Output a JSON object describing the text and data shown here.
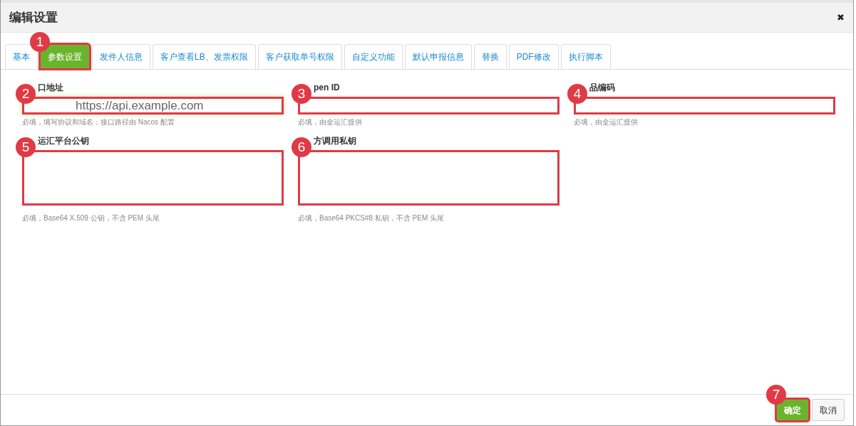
{
  "dialog": {
    "title": "编辑设置",
    "close": "✖"
  },
  "tabs": [
    {
      "label": "基本",
      "selected": false
    },
    {
      "label": "参数设置",
      "selected": true,
      "callout": "1"
    },
    {
      "label": "发件人信息",
      "selected": false
    },
    {
      "label": "客户查看LB、发票权限",
      "selected": false
    },
    {
      "label": "客户获取单号权限",
      "selected": false
    },
    {
      "label": "自定义功能",
      "selected": false
    },
    {
      "label": "默认申报信息",
      "selected": false
    },
    {
      "label": "替换",
      "selected": false
    },
    {
      "label": "PDF修改",
      "selected": false
    },
    {
      "label": "执行脚本",
      "selected": false
    }
  ],
  "fields": [
    {
      "kind": "input",
      "label": "口地址",
      "value": "https://api.example.com",
      "hint": "必填，填写协议和域名；接口路径由 Nacos 配置",
      "callout": "2",
      "focused": true
    },
    {
      "kind": "input",
      "label": "pen ID",
      "hint": "必填，由全运汇提供",
      "callout": "3",
      "focused": false
    },
    {
      "kind": "input",
      "label": "品编码",
      "hint": "必填，由全运汇提供",
      "callout": "4",
      "focused": false
    },
    {
      "kind": "textarea",
      "label": "运汇平台公钥",
      "hint": "必填，Base64 X.509 公钥，不含 PEM 头尾",
      "callout": "5",
      "focused": false
    },
    {
      "kind": "textarea",
      "label": "方调用私钥",
      "hint": "必填，Base64 PKCS#8 私钥，不含 PEM 头尾",
      "callout": "6",
      "focused": false
    }
  ],
  "buttons": [
    {
      "label": "确定",
      "kind": "primary",
      "callout": "7"
    },
    {
      "label": "取消",
      "kind": "default"
    }
  ]
}
